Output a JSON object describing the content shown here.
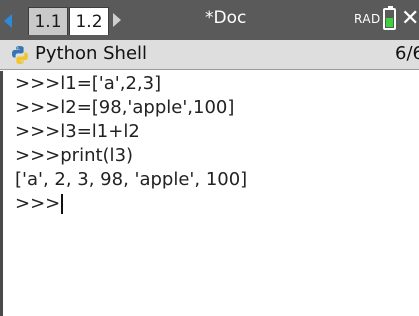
{
  "tabs": [
    {
      "label": "1.1",
      "active": false
    },
    {
      "label": "1.2",
      "active": true
    }
  ],
  "document": {
    "title": "*Doc"
  },
  "status": {
    "angle_mode": "RAD",
    "battery_level": 0.5,
    "battery_color": "#3cd23c"
  },
  "app": {
    "title": "Python Shell",
    "page_count": "6/6",
    "icon": "python-icon"
  },
  "shell": {
    "prompt": ">>>",
    "lines": [
      ">>>l1=['a',2,3]",
      ">>>l2=[98,'apple',100]",
      ">>>l3=l1+l2",
      ">>>print(l3)",
      "['a', 2, 3, 98, 'apple', 100]"
    ]
  },
  "colors": {
    "tabbar_bg": "#5a5a5a",
    "header_bg": "#dedede",
    "nav_accent": "#2e8ad8"
  }
}
